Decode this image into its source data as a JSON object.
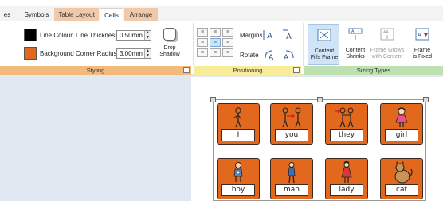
{
  "tabs": [
    {
      "label": "es"
    },
    {
      "label": "Symbols"
    },
    {
      "label": "Table Layout"
    },
    {
      "label": "Cells"
    },
    {
      "label": "Arrange"
    }
  ],
  "ribbon": {
    "styling": {
      "title": "Styling",
      "line_colour": {
        "label": "Line Colour",
        "color": "#000000"
      },
      "background": {
        "label": "Background",
        "color": "#e2681e"
      },
      "line_thickness": {
        "label": "Line Thickness:",
        "value": "0.50mm"
      },
      "corner_radius": {
        "label": "Corner Radius:",
        "value": "3.00mm"
      },
      "drop_shadow": {
        "line1": "Drop",
        "line2": "Shadow"
      }
    },
    "positioning": {
      "title": "Positioning",
      "margins_label": "Margins",
      "rotate_label": "Rotate"
    },
    "sizing": {
      "title": "Sizing Types",
      "buttons": [
        {
          "line1": "Content",
          "line2": "Fills Frame",
          "active": true
        },
        {
          "line1": "Content",
          "line2": "Shrinks",
          "active": false
        },
        {
          "line1": "Frame Grows",
          "line2": "with Content",
          "active": false
        },
        {
          "line1": "Frame",
          "line2": "is Fixed",
          "active": false
        }
      ]
    }
  },
  "cards": [
    {
      "word": "I",
      "symbol": "person-pointing-self-icon"
    },
    {
      "word": "you",
      "symbol": "person-pointing-other-icon"
    },
    {
      "word": "they",
      "symbol": "group-people-icon"
    },
    {
      "word": "girl",
      "symbol": "girl-icon"
    },
    {
      "word": "boy",
      "symbol": "boy-icon"
    },
    {
      "word": "man",
      "symbol": "man-icon"
    },
    {
      "word": "lady",
      "symbol": "lady-icon"
    },
    {
      "word": "cat",
      "symbol": "cat-icon"
    }
  ],
  "colors": {
    "card_fill": "#e2681e",
    "card_border": "#3b2a20",
    "canvas_bg": "#e0e8f1",
    "styling_group": "#f4b97c",
    "positioning_group": "#f8ec98",
    "sizing_group": "#bfe0b1"
  }
}
